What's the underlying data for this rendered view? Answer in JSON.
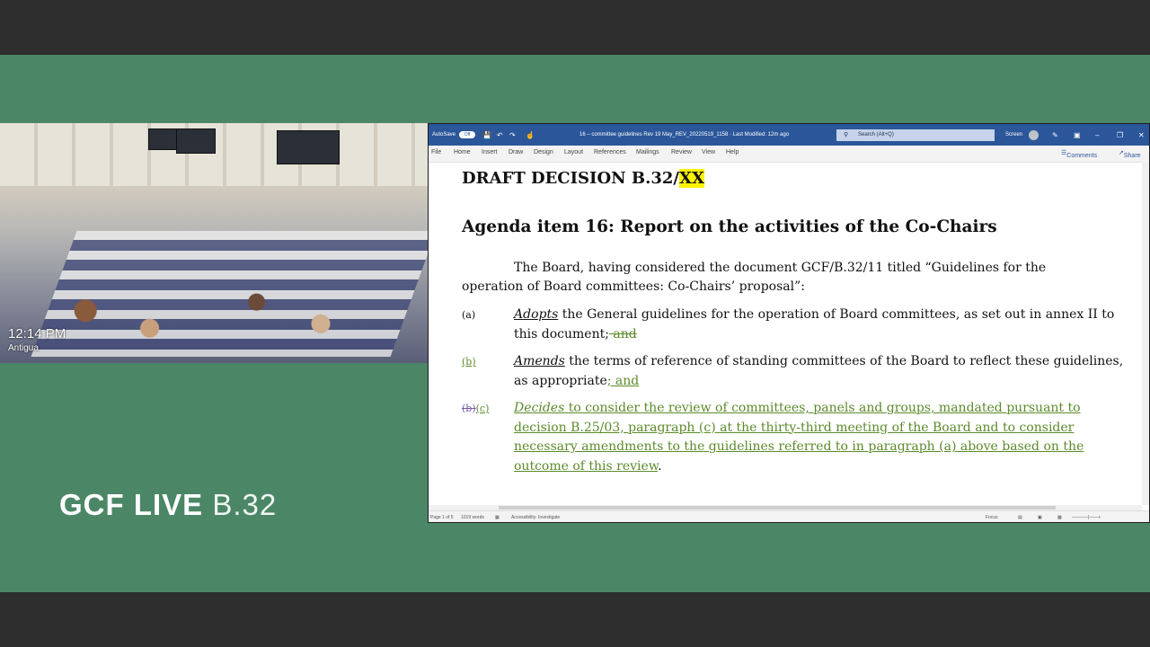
{
  "camera": {
    "time": "12:14 PM",
    "location": "Antigua"
  },
  "branding": {
    "bold": "GCF LIVE ",
    "light": "B.32"
  },
  "word": {
    "titlebar": {
      "autosave": "AutoSave",
      "toggle": "Off",
      "doc_title": "16 – committee guidelines Rev 19 May_REV_20220519_1158 · Last Modified: 12m ago",
      "search_placeholder": "Search (Alt+Q)",
      "account": "Screen"
    },
    "menu": [
      "File",
      "Home",
      "Insert",
      "Draw",
      "Design",
      "Layout",
      "References",
      "Mailings",
      "Review",
      "View",
      "Help"
    ],
    "menu_right": {
      "comments": "Comments",
      "share": "Share"
    },
    "document": {
      "heading_prefix": "DRAFT DECISION B.32/",
      "heading_highlight": "XX",
      "agenda": "Agenda item 16:  Report on the activities of the Co-Chairs",
      "intro_line1": "The Board, having considered the document GCF/B.32/11 titled “Guidelines for the",
      "intro_line2": "operation of Board committees:  Co-Chairs’ proposal”:",
      "item_a": {
        "num": "(a)",
        "verb": "Adopts",
        "text": " the General guidelines for the operation of Board committees, as set out in annex II to this document;",
        "deleted": " and"
      },
      "item_b": {
        "num": "(b)",
        "verb": "Amends",
        "text": " the terms of reference of standing committees of the Board to reflect these guidelines, as appropriate",
        "inserted": "; and"
      },
      "item_c": {
        "num_deleted": "(b)",
        "num_inserted": "(c)",
        "verb": "Decides",
        "text": " to consider the review of committees, panels and groups, mandated pursuant to decision B.25/03, paragraph (c) at the thirty-third meeting of the Board and to consider necessary amendments to the guidelines referred to in paragraph (a) above based on the outcome of this review",
        "end": "."
      }
    },
    "status": {
      "page": "Page 1 of 5",
      "words": "1019 words",
      "accessibility": "Accessibility: Investigate",
      "focus": "Focus"
    }
  }
}
